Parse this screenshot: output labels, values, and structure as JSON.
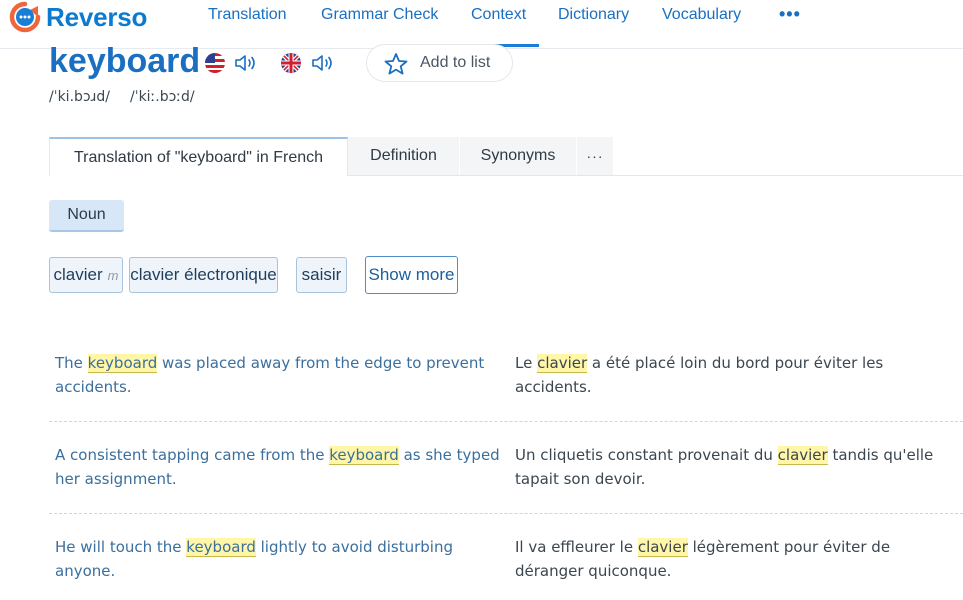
{
  "brand": {
    "name": "Reverso"
  },
  "nav": {
    "items": [
      "Translation",
      "Grammar Check",
      "Context",
      "Dictionary",
      "Vocabulary"
    ],
    "active": "Context",
    "more": "•••"
  },
  "entry": {
    "word": "keyboard",
    "pron_us": "/ˈki.bɔɹd/",
    "pron_uk": "/ˈkiː.bɔːd/",
    "add_to_list": "Add to list"
  },
  "tabs": {
    "translation": "Translation of \"keyboard\" in French",
    "definition": "Definition",
    "synonyms": "Synonyms",
    "more": "···"
  },
  "pos": "Noun",
  "translations": [
    {
      "text": "clavier",
      "gender": "m"
    },
    {
      "text": "clavier électronique",
      "gender": ""
    },
    {
      "text": "saisir",
      "gender": ""
    }
  ],
  "show_more": "Show more",
  "examples": [
    {
      "src_before": "The ",
      "src_hl": "keyboard",
      "src_after": " was placed away from the edge to prevent accidents.",
      "trg_before": "Le ",
      "trg_hl": "clavier",
      "trg_after": " a été placé loin du bord pour éviter les accidents."
    },
    {
      "src_before": "A consistent tapping came from the ",
      "src_hl": "keyboard",
      "src_after": " as she typed her assignment.",
      "trg_before": "Un cliquetis constant provenait du ",
      "trg_hl": "clavier",
      "trg_after": " tandis qu'elle tapait son devoir."
    },
    {
      "src_before": "He will touch the ",
      "src_hl": "keyboard",
      "src_after": " lightly to avoid disturbing anyone.",
      "trg_before": "Il va effleurer le ",
      "trg_hl": "clavier",
      "trg_after": " légèrement pour éviter de déranger quiconque."
    }
  ],
  "colors": {
    "brand_blue": "#1a6fc2",
    "logo_orange": "#f0663a",
    "highlight": "#fff6a8",
    "pos_bg": "#d7e7f7"
  }
}
